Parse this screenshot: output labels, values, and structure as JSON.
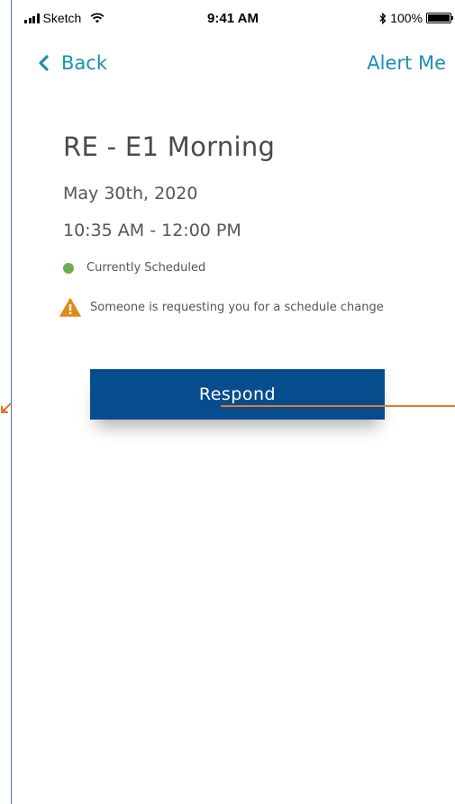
{
  "status_bar": {
    "carrier": "Sketch",
    "time": "9:41 AM",
    "battery": "100%",
    "battery_level": 1.0
  },
  "nav": {
    "back_label": "Back",
    "alert_label": "Alert Me"
  },
  "shift": {
    "title": "RE -  E1 Morning",
    "date": "May 30th, 2020",
    "time_range": "10:35 AM - 12:00 PM"
  },
  "statuses": {
    "scheduled": "Currently Scheduled",
    "request": "Someone is requesting you for a schedule change"
  },
  "actions": {
    "respond_label": "Respond"
  },
  "colors": {
    "accent": "#1a8fb8",
    "primary_button": "#074d8e",
    "scheduled_dot": "#6ab04c",
    "warning": "#e08a1e",
    "annotation": "#e07b2a",
    "frame_border": "#4a74c8"
  },
  "icons": {
    "back": "chevron-left-icon",
    "warning": "warning-triangle-icon",
    "status": "status-dot-icon",
    "signal": "cellular-signal-icon",
    "wifi": "wifi-icon",
    "bluetooth": "bluetooth-icon",
    "battery": "battery-icon"
  }
}
